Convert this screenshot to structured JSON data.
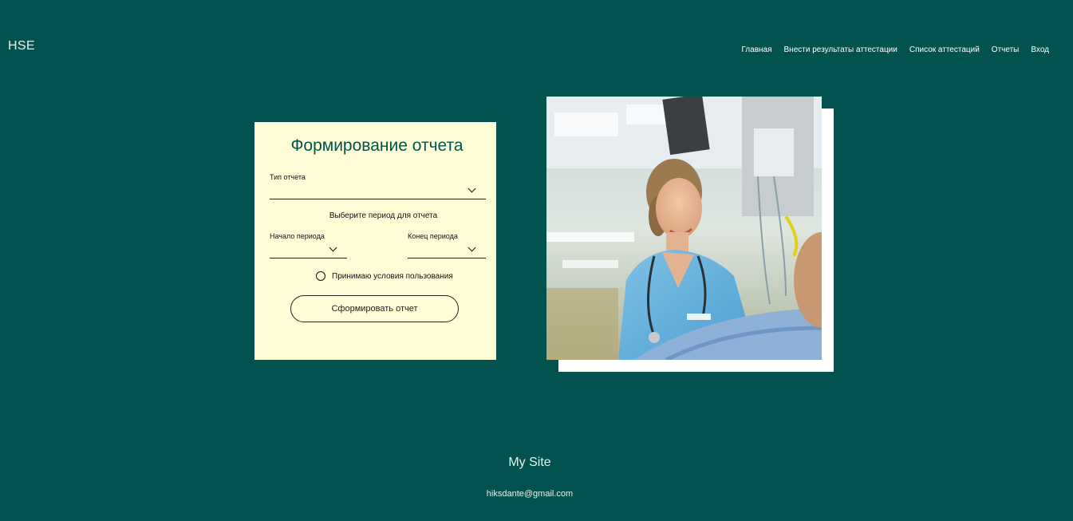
{
  "header": {
    "logo": "HSE",
    "nav": [
      {
        "label": "Главная"
      },
      {
        "label": "Внести результаты аттестации"
      },
      {
        "label": "Список аттестаций"
      },
      {
        "label": "Отчеты"
      },
      {
        "label": "Вход"
      }
    ]
  },
  "form": {
    "title": "Формирование отчета",
    "report_type_label": "Тип отчета",
    "report_type_value": "",
    "period_hint": "Выберите период для отчета",
    "start_label": "Начало периода",
    "start_value": "",
    "end_label": "Конец периода",
    "end_value": "",
    "terms_label": "Принимаю условия пользования",
    "terms_checked": false,
    "submit_label": "Сформировать отчет"
  },
  "colors": {
    "background": "#02534f",
    "card": "#fffdd6",
    "title": "#02534f"
  },
  "footer": {
    "site_name": "My Site",
    "email": "hiksdante@gmail.com"
  }
}
